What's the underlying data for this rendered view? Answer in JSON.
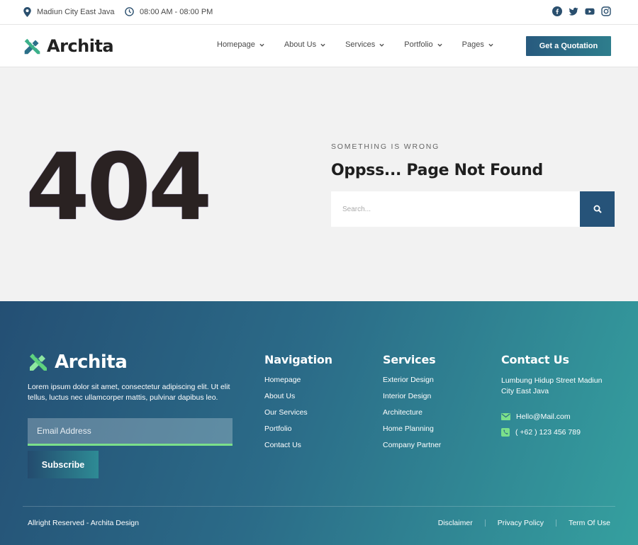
{
  "topbar": {
    "location": "Madiun City East Java",
    "hours": "08:00 AM - 08:00 PM",
    "social": [
      "facebook-icon",
      "twitter-icon",
      "youtube-icon",
      "instagram-icon"
    ]
  },
  "header": {
    "brand": "Archita",
    "nav": [
      "Homepage",
      "About Us",
      "Services",
      "Portfolio",
      "Pages"
    ],
    "cta": "Get a Quotation"
  },
  "hero": {
    "code": "404",
    "eyebrow": "SOMETHING IS WRONG",
    "headline": "Oppss... Page Not Found",
    "search_placeholder": "Search..."
  },
  "footer": {
    "brand": "Archita",
    "description": "Lorem ipsum dolor sit amet, consectetur adipiscing elit. Ut elit tellus, luctus nec ullamcorper mattis, pulvinar dapibus leo.",
    "email_placeholder": "Email Address",
    "subscribe": "Subscribe",
    "navigation": {
      "title": "Navigation",
      "links": [
        "Homepage",
        "About Us",
        "Our Services",
        "Portfolio",
        "Contact Us"
      ]
    },
    "services": {
      "title": "Services",
      "links": [
        "Exterior Design",
        "Interior Design",
        "Architecture",
        "Home Planning",
        "Company Partner"
      ]
    },
    "contact": {
      "title": "Contact Us",
      "address": "Lumbung Hidup Street Madiun City East Java",
      "email": "Hello@Mail.com",
      "phone": "( +62 ) 123 456 789"
    },
    "copyright": "Allright Reserved - Archita Design",
    "legal": [
      "Disclaimer",
      "Privacy Policy",
      "Term Of Use"
    ]
  },
  "colors": {
    "primary": "#265379",
    "accent_green": "#7be08a",
    "hero_bg": "#f2f2f2"
  }
}
